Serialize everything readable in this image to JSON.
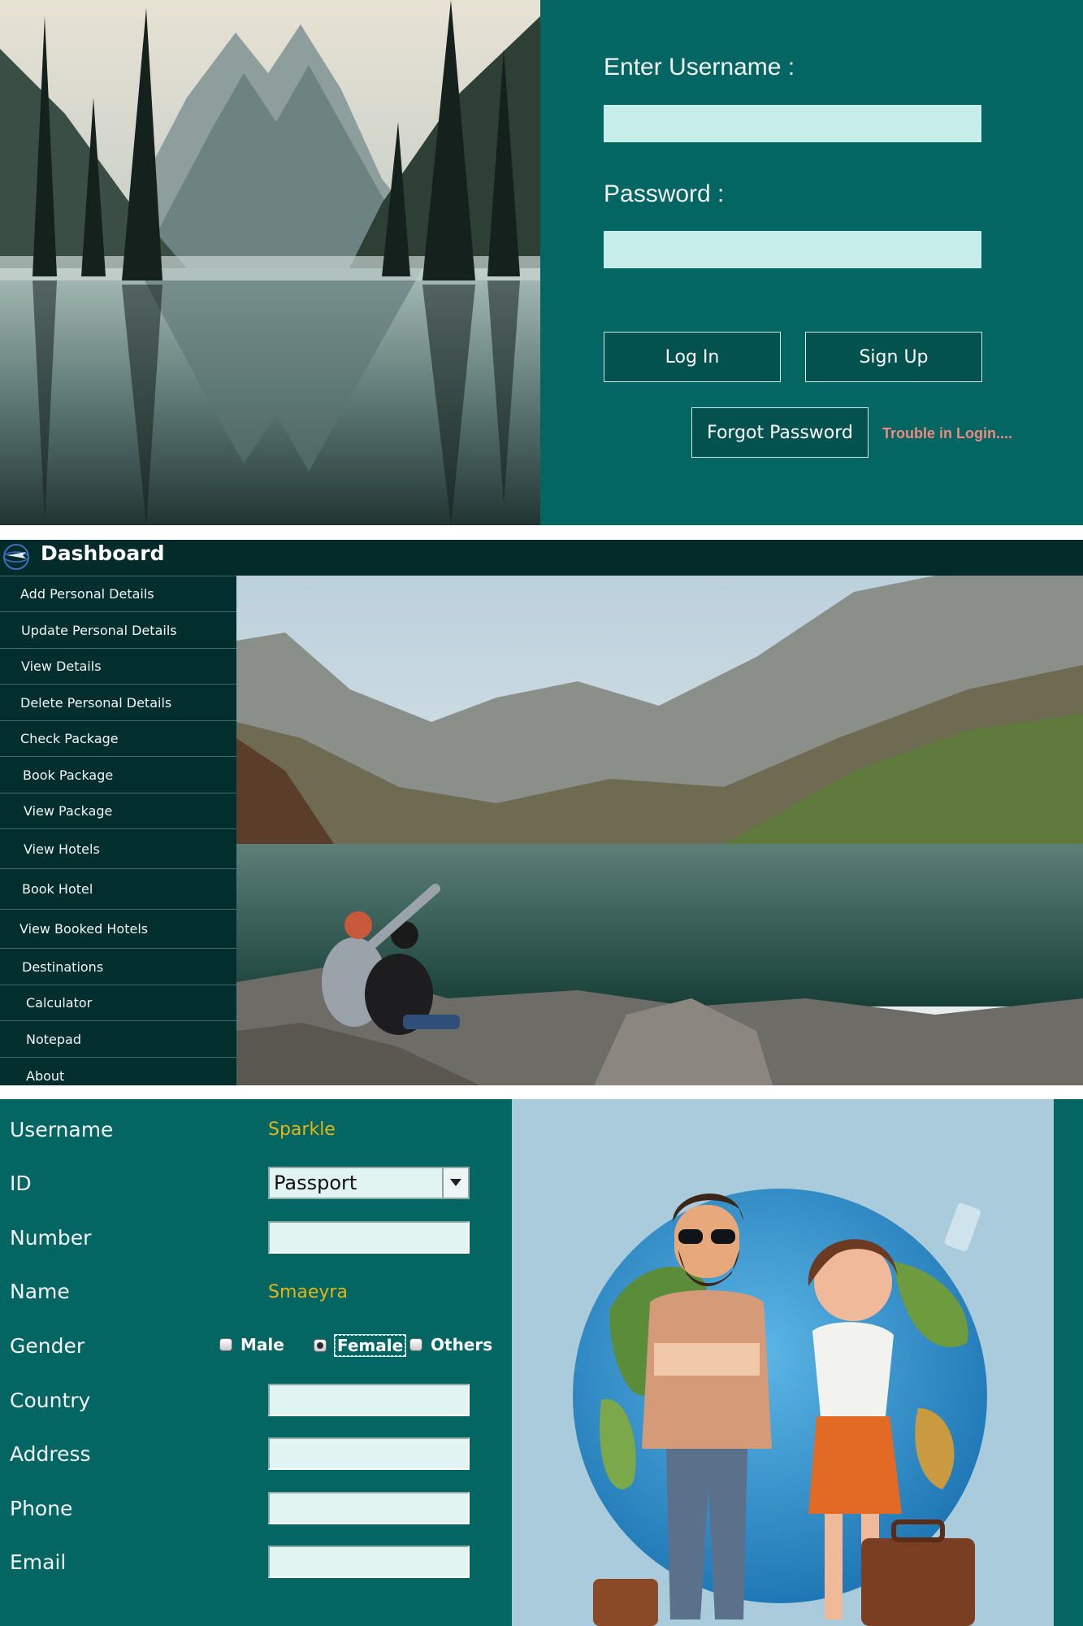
{
  "login": {
    "username_label": "Enter Username :",
    "username_value": "",
    "password_label": "Password :",
    "password_value": "",
    "login_button": "Log In",
    "signup_button": "Sign Up",
    "forgot_button": "Forgot Password",
    "trouble_link": "Trouble in Login....",
    "colors": {
      "panel": "#036663",
      "input": "#c6ede8",
      "link": "#f08a80"
    },
    "photo_icon": "mountain-lake-reflection-photo"
  },
  "dashboard": {
    "title": "Dashboard",
    "logo_icon": "airplane-globe-logo",
    "menu": [
      "Add Personal Details",
      "Update Personal Details",
      "View Details",
      "Delete Personal Details",
      "Check Package",
      "Book Package",
      "View Package",
      "View Hotels",
      "Book Hotel",
      "View Booked Hotels",
      "Destinations",
      "Calculator",
      "Notepad",
      "About"
    ],
    "photo_icon": "hikers-by-mountain-lake-photo",
    "colors": {
      "sidebar": "#022f2d",
      "header": "#022b29"
    }
  },
  "details": {
    "username_label": "Username",
    "username_value": "Sparkle",
    "id_label": "ID",
    "id_selected": "Passport",
    "number_label": "Number",
    "number_value": "",
    "name_label": "Name",
    "name_value": "Smaeyra",
    "gender_label": "Gender",
    "gender_options": [
      "Male",
      "Female",
      "Others"
    ],
    "gender_selected": "Female",
    "country_label": "Country",
    "country_value": "",
    "address_label": "Address",
    "address_value": "",
    "phone_label": "Phone",
    "phone_value": "",
    "email_label": "Email",
    "email_value": "",
    "illustration_icon": "travelers-with-globe-illustration",
    "colors": {
      "panel": "#036663",
      "value": "#e3b616",
      "input": "#e1f4f2"
    }
  }
}
